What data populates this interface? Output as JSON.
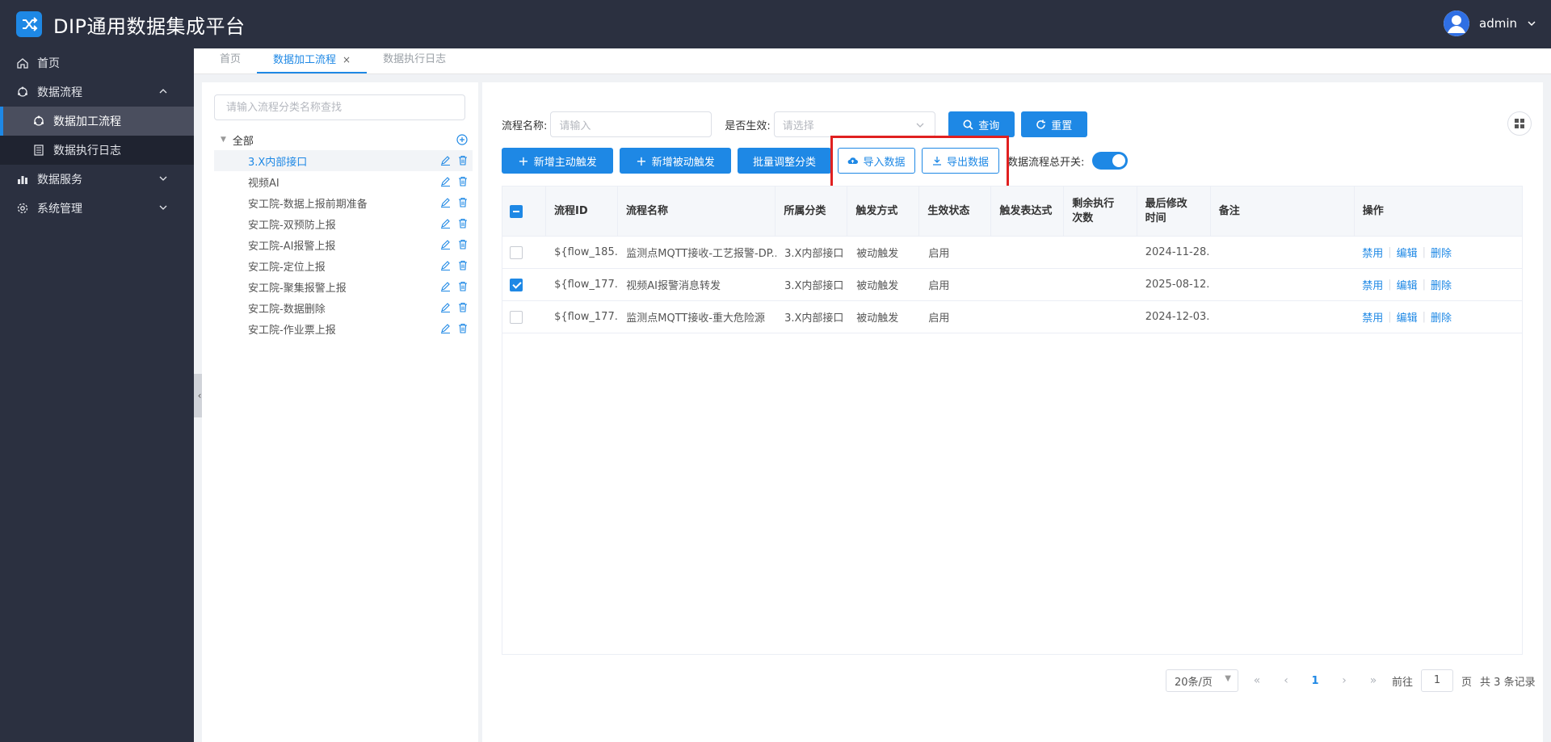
{
  "app": {
    "title": "DIP通用数据集成平台",
    "user": "admin"
  },
  "sidebar": {
    "items": [
      {
        "label": "首页"
      },
      {
        "label": "数据流程"
      },
      {
        "label": "数据加工流程"
      },
      {
        "label": "数据执行日志"
      },
      {
        "label": "数据服务"
      },
      {
        "label": "系统管理"
      }
    ]
  },
  "tabs": [
    {
      "label": "首页"
    },
    {
      "label": "数据加工流程",
      "close": "×"
    },
    {
      "label": "数据执行日志"
    }
  ],
  "tree": {
    "search_placeholder": "请输入流程分类名称查找",
    "root": "全部",
    "nodes": [
      "3.X内部接口",
      "视频AI",
      "安工院-数据上报前期准备",
      "安工院-双预防上报",
      "安工院-AI报警上报",
      "安工院-定位上报",
      "安工院-聚集报警上报",
      "安工院-数据删除",
      "安工院-作业票上报"
    ]
  },
  "filters": {
    "name_label": "流程名称:",
    "name_placeholder": "请输入",
    "active_label": "是否生效:",
    "active_placeholder": "请选择",
    "query": "查询",
    "reset": "重置"
  },
  "actions": {
    "add_active": "新增主动触发",
    "add_passive": "新增被动触发",
    "batch_category": "批量调整分类",
    "import": "导入数据",
    "export": "导出数据",
    "master_switch_label": "数据流程总开关:"
  },
  "table": {
    "headers": [
      "流程ID",
      "流程名称",
      "所属分类",
      "触发方式",
      "生效状态",
      "触发表达式",
      "剩余执行次数",
      "最后修改时间",
      "备注",
      "操作"
    ],
    "rows": [
      {
        "id": "${flow_185...",
        "name": "监测点MQTT接收-工艺报警-DP...",
        "category": "3.X内部接口",
        "trigger": "被动触发",
        "status": "启用",
        "expr": "",
        "remain": "",
        "modified": "2024-11-28...",
        "note": "",
        "checked": false
      },
      {
        "id": "${flow_177...",
        "name": "视频AI报警消息转发",
        "category": "3.X内部接口",
        "trigger": "被动触发",
        "status": "启用",
        "expr": "",
        "remain": "",
        "modified": "2025-08-12...",
        "note": "",
        "checked": true
      },
      {
        "id": "${flow_177...",
        "name": "监测点MQTT接收-重大危险源",
        "category": "3.X内部接口",
        "trigger": "被动触发",
        "status": "启用",
        "expr": "",
        "remain": "",
        "modified": "2024-12-03...",
        "note": "",
        "checked": false
      }
    ],
    "ops": {
      "disable": "禁用",
      "edit": "编辑",
      "delete": "删除"
    }
  },
  "pagination": {
    "page_size": "20条/页",
    "current_page": "1",
    "goto_label": "前往",
    "goto_value": "1",
    "page_suffix": "页",
    "total": "共 3 条记录"
  },
  "colors": {
    "accent": "#1e88e5",
    "header_bg": "#2b3040",
    "highlight": "#e02020"
  }
}
